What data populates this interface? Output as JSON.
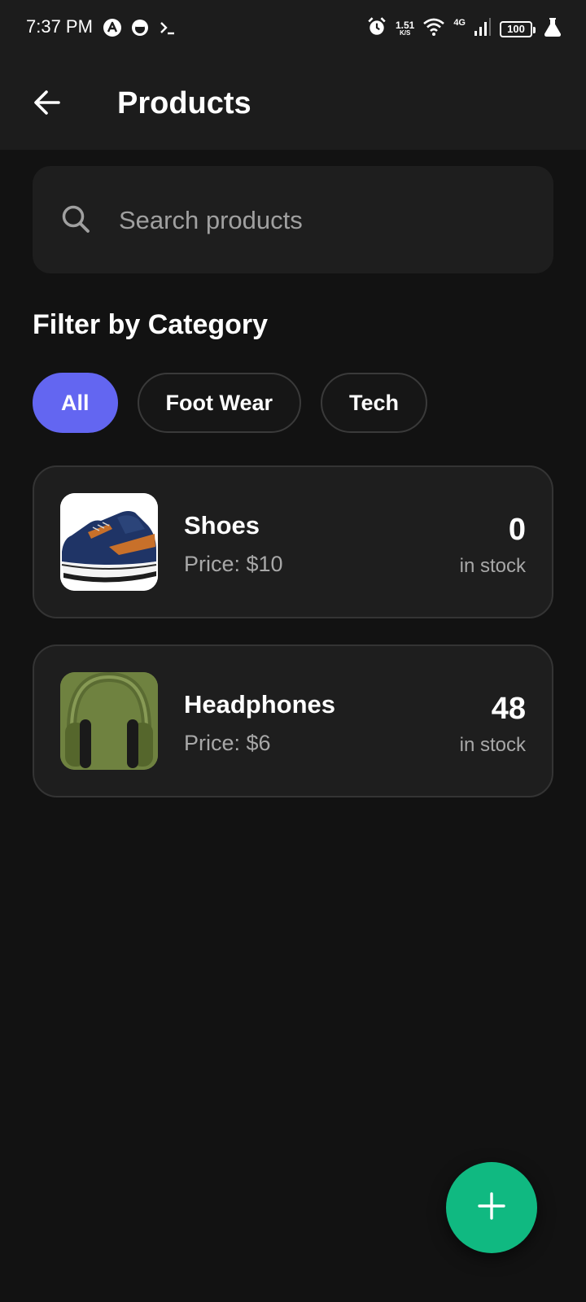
{
  "status_bar": {
    "time": "7:37 PM",
    "net_speed_value": "1.51",
    "net_speed_unit": "K/S",
    "network_type": "4G",
    "battery": "100",
    "left_icons": [
      "app-a-icon",
      "app-face-icon",
      "terminal-icon"
    ],
    "right_icons": [
      "alarm-icon",
      "wifi-icon",
      "signal-icon",
      "battery-icon",
      "flask-icon"
    ]
  },
  "app_bar": {
    "back_icon": "arrow-left-icon",
    "title": "Products"
  },
  "search": {
    "placeholder": "Search products",
    "value": "",
    "icon": "search-icon"
  },
  "filter": {
    "title": "Filter by Category",
    "chips": [
      {
        "label": "All",
        "active": true
      },
      {
        "label": "Foot Wear",
        "active": false
      },
      {
        "label": "Tech",
        "active": false
      }
    ]
  },
  "products": [
    {
      "name": "Shoes",
      "price": "Price: $10",
      "stock": "0",
      "stock_label": "in stock",
      "image": "shoe-image"
    },
    {
      "name": "Headphones",
      "price": "Price: $6",
      "stock": "48",
      "stock_label": "in stock",
      "image": "headphones-image"
    }
  ],
  "fab": {
    "icon": "plus-icon"
  },
  "colors": {
    "background": "#121212",
    "surface": "#1e1e1e",
    "accent": "#6366f1",
    "fab": "#10b981",
    "muted_text": "#a8a8a8"
  }
}
